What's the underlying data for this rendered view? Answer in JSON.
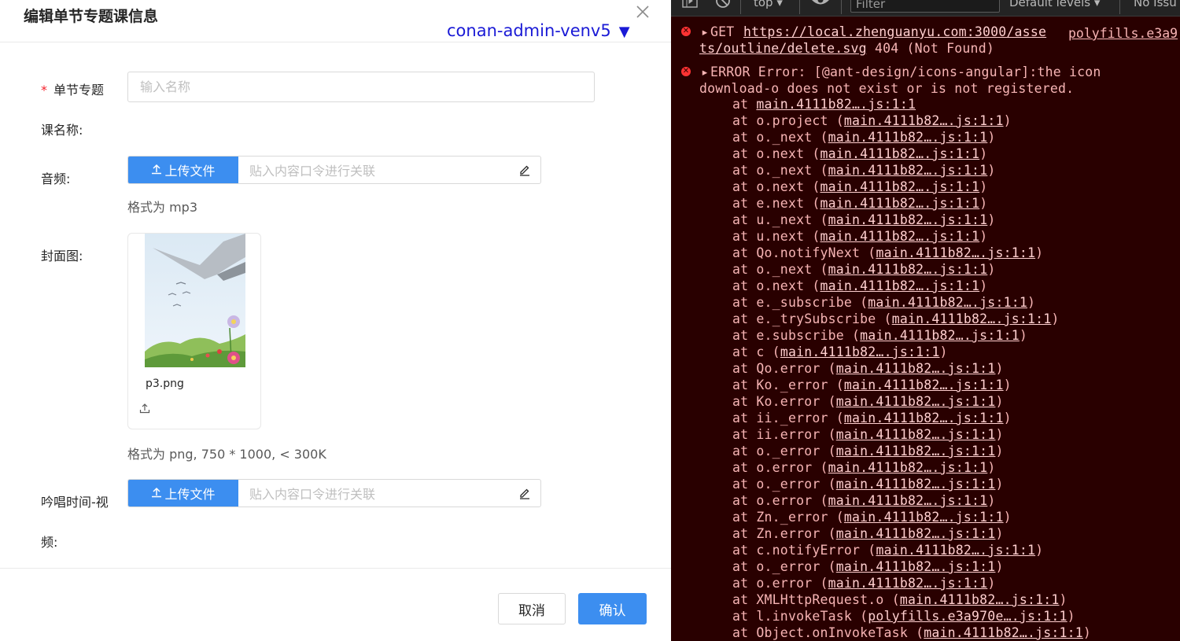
{
  "modal": {
    "title": "编辑单节专题课信息",
    "env": "conan-admin-venv5",
    "env_arrow": "▼",
    "fields": {
      "topic_label": "单节专题",
      "topic_placeholder": "输入名称",
      "course_label": "课名称:",
      "audio_label": "音频:",
      "upload_label": "上传文件",
      "paste_placeholder": "贴入内容口令进行关联",
      "audio_hint": "格式为 mp3",
      "cover_label": "封面图:",
      "cover_filename": "p3.png",
      "cover_hint": "格式为 png, 750 * 1000, < 300K",
      "video_label_1": "吟唱时间-视",
      "video_label_2": "频:"
    },
    "buttons": {
      "cancel": "取消",
      "ok": "确认"
    },
    "colors": {
      "primary": "#3c8ef0",
      "env": "#1a1ad6",
      "required": "#f5222d"
    }
  },
  "devtools": {
    "context": "top",
    "filter_placeholder": "Filter",
    "levels": "Default levels",
    "issues": "No Issu",
    "get_error": {
      "method": "GET",
      "url_1": "https://local.zhenguanyu.com:3000/asse",
      "url_2": "ts/outline/delete.svg",
      "status": "404 (Not Found)",
      "source": "polyfills.e3a9"
    },
    "ant_error": {
      "line1": "ERROR Error: [@ant-design/icons-angular]:the icon",
      "line2": "download-o does not exist or is not registered."
    },
    "stack": [
      {
        "fn": "",
        "src": "main.4111b82….js:1:1"
      },
      {
        "fn": "o.project",
        "src": "main.4111b82….js:1:1"
      },
      {
        "fn": "o._next",
        "src": "main.4111b82….js:1:1"
      },
      {
        "fn": "o.next",
        "src": "main.4111b82….js:1:1"
      },
      {
        "fn": "o._next",
        "src": "main.4111b82….js:1:1"
      },
      {
        "fn": "o.next",
        "src": "main.4111b82….js:1:1"
      },
      {
        "fn": "e.next",
        "src": "main.4111b82….js:1:1"
      },
      {
        "fn": "u._next",
        "src": "main.4111b82….js:1:1"
      },
      {
        "fn": "u.next",
        "src": "main.4111b82….js:1:1"
      },
      {
        "fn": "Qo.notifyNext",
        "src": "main.4111b82….js:1:1"
      },
      {
        "fn": "o._next",
        "src": "main.4111b82….js:1:1"
      },
      {
        "fn": "o.next",
        "src": "main.4111b82….js:1:1"
      },
      {
        "fn": "e._subscribe",
        "src": "main.4111b82….js:1:1"
      },
      {
        "fn": "e._trySubscribe",
        "src": "main.4111b82….js:1:1"
      },
      {
        "fn": "e.subscribe",
        "src": "main.4111b82….js:1:1"
      },
      {
        "fn": "c",
        "src": "main.4111b82….js:1:1"
      },
      {
        "fn": "Qo.error",
        "src": "main.4111b82….js:1:1"
      },
      {
        "fn": "Ko._error",
        "src": "main.4111b82….js:1:1"
      },
      {
        "fn": "Ko.error",
        "src": "main.4111b82….js:1:1"
      },
      {
        "fn": "ii._error",
        "src": "main.4111b82….js:1:1"
      },
      {
        "fn": "ii.error",
        "src": "main.4111b82….js:1:1"
      },
      {
        "fn": "o._error",
        "src": "main.4111b82….js:1:1"
      },
      {
        "fn": "o.error",
        "src": "main.4111b82….js:1:1"
      },
      {
        "fn": "o._error",
        "src": "main.4111b82….js:1:1"
      },
      {
        "fn": "o.error",
        "src": "main.4111b82….js:1:1"
      },
      {
        "fn": "Zn._error",
        "src": "main.4111b82….js:1:1"
      },
      {
        "fn": "Zn.error",
        "src": "main.4111b82….js:1:1"
      },
      {
        "fn": "c.notifyError",
        "src": "main.4111b82….js:1:1"
      },
      {
        "fn": "o._error",
        "src": "main.4111b82….js:1:1"
      },
      {
        "fn": "o.error",
        "src": "main.4111b82….js:1:1"
      },
      {
        "fn": "XMLHttpRequest.o",
        "src": "main.4111b82….js:1:1"
      },
      {
        "fn": "l.invokeTask",
        "src": "polyfills.e3a970e….js:1:1"
      },
      {
        "fn": "Object.onInvokeTask",
        "src": "main.4111b82….js:1:1"
      }
    ],
    "colors": {
      "bg": "#290000",
      "text": "#f7b5b5",
      "error_icon": "#ff3333"
    }
  }
}
